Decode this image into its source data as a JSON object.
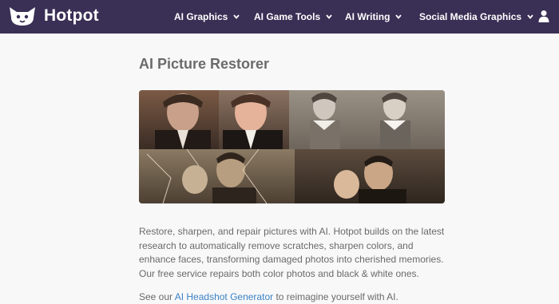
{
  "header": {
    "brand": "Hotpot",
    "menu": [
      {
        "label": "AI Graphics"
      },
      {
        "label": "AI Game Tools"
      },
      {
        "label": "AI Writing"
      },
      {
        "label": "Social Media Graphics"
      }
    ]
  },
  "main": {
    "title": "AI Picture Restorer",
    "description": "Restore, sharpen, and repair pictures with AI. Hotpot builds on the latest research to automatically remove scratches, sharpen colors, and enhance faces, transforming damaged photos into cherished memories. Our free service repairs both color photos and black & white ones.",
    "see_prefix": "See our ",
    "see_link": "AI Headshot Generator",
    "see_suffix": " to reimagine yourself with AI."
  },
  "colors": {
    "nav_bg": "#3a2f55",
    "link": "#3b82c4",
    "page_bg": "#f8f8f9"
  },
  "icons": {
    "logo": "dog-face-logo-icon",
    "chevron": "chevron-down-icon",
    "user": "user-icon"
  }
}
